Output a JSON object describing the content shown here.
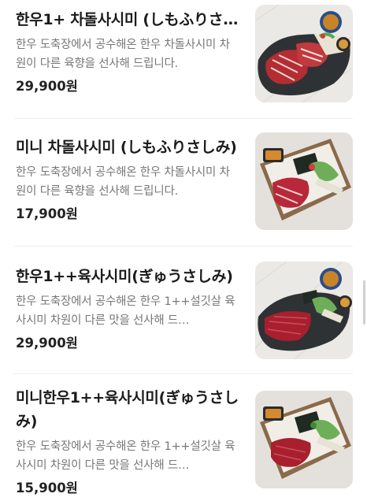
{
  "menu": {
    "items": [
      {
        "name": "한우1+ 차돌사시미 (しもふりさし…",
        "description": "한우 도축장에서 공수해온 한우 차돌사시미 차원이 다른 육향을 선사해 드립니다.",
        "price": "29,900원",
        "image": "beef-sashimi-slate-platter"
      },
      {
        "name": "미니 차돌사시미 (しもふりさしみ)",
        "description": "한우 도축장에서 공수해온 한우 차돌사시미 차원이 다른 육향을 선사해 드립니다.",
        "price": "17,900원",
        "image": "beef-sashimi-wooden-box"
      },
      {
        "name": "한우1++육사시미(ぎゅうさしみ)",
        "description": "한우 도축장에서 공수해온 한우 1++설깃살 육사시미 차원이 다른 맛을 선사해 드…",
        "price": "29,900원",
        "image": "yuk-sashimi-slate-platter"
      },
      {
        "name": "미니한우1++육사시미(ぎゅうさしみ)",
        "description": "한우 도축장에서 공수해온 한우 1++설깃살 육사시미 차원이 다른 맛을 선사해 드…",
        "price": "15,900원",
        "image": "yuk-sashimi-wooden-box"
      }
    ]
  }
}
